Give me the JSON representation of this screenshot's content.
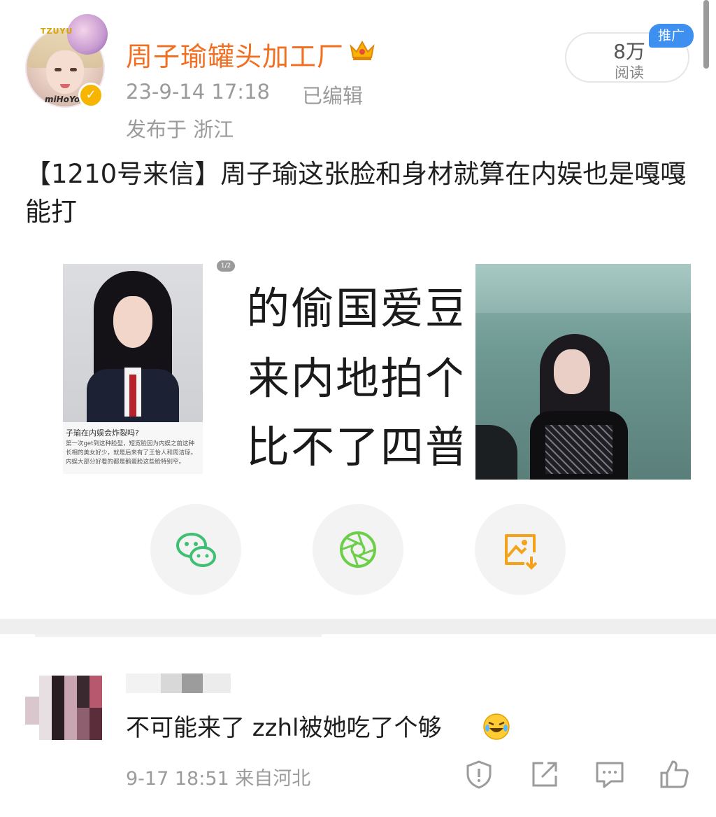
{
  "post": {
    "username": "周子瑜罐头加工厂",
    "avatar_tag": "TZUYU",
    "avatar_brand": "miHoYo",
    "time": "23-9-14 17:18",
    "edited": "已编辑",
    "location": "发布于 浙江",
    "reads_count": "8万",
    "reads_label": "阅读",
    "promo_badge": "推广",
    "text": "【1210号来信】周子瑜这张脸和身材就算在内娱也是嘎嘎能打",
    "images": {
      "pager": "1/2",
      "caption_title": "子瑜在内娱会炸裂吗?",
      "caption_body": "第一次get到这种脸型，短宽脸因为内娱之前这种长相的美女好少，就是后来有了王怡人和周洁琼。内娱大部分好看的都是鹅蛋脸这些脸特别窄。",
      "text_image_lines": [
        "的偷国爱豆",
        "来内地拍个",
        "比不了四普"
      ]
    }
  },
  "share": {
    "wechat": "wechat-icon",
    "moments": "moments-icon",
    "save_image": "save-image-icon",
    "colors": {
      "wechat": "#3fbf74",
      "moments": "#6ccf4a",
      "save": "#f5a21b"
    }
  },
  "comment": {
    "text": "不可能来了 zzhl被她吃了个够",
    "time": "9-17 18:51",
    "source": "来自河北",
    "actions": [
      "report-icon",
      "share-icon",
      "reply-icon",
      "like-icon"
    ]
  },
  "colors": {
    "username": "#f26f21",
    "meta": "#9b9b9b",
    "promo": "#3d8ff0"
  }
}
